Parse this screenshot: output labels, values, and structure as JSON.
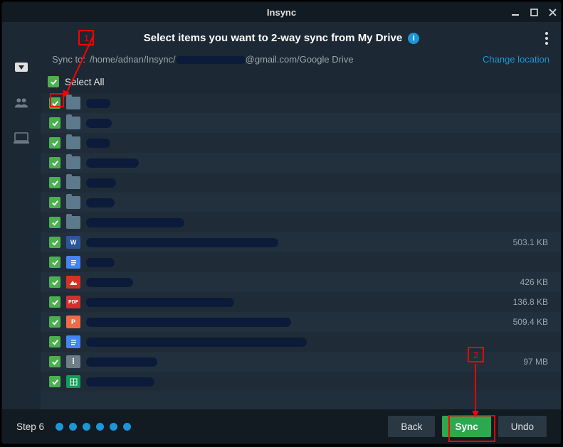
{
  "window": {
    "title": "Insync"
  },
  "header": {
    "title": "Select items you want to 2-way sync from My Drive"
  },
  "sync": {
    "label": "Sync to:",
    "path_prefix": "/home/adnan/Insync/",
    "path_suffix": "@gmail.com/Google Drive",
    "change": "Change location"
  },
  "selectAll": {
    "label": "Select All"
  },
  "items": [
    {
      "kind": "folder",
      "nameWidth": 34,
      "size": ""
    },
    {
      "kind": "folder",
      "nameWidth": 36,
      "size": ""
    },
    {
      "kind": "folder",
      "nameWidth": 34,
      "size": ""
    },
    {
      "kind": "folder",
      "nameWidth": 74,
      "size": ""
    },
    {
      "kind": "folder",
      "nameWidth": 42,
      "size": ""
    },
    {
      "kind": "folder",
      "nameWidth": 40,
      "size": ""
    },
    {
      "kind": "folder",
      "nameWidth": 138,
      "size": ""
    },
    {
      "kind": "word",
      "nameWidth": 270,
      "size": "503.1 KB"
    },
    {
      "kind": "gdoc",
      "nameWidth": 40,
      "size": ""
    },
    {
      "kind": "image",
      "nameWidth": 66,
      "size": "426 KB"
    },
    {
      "kind": "pdf",
      "nameWidth": 208,
      "size": "136.8 KB"
    },
    {
      "kind": "ppt",
      "nameWidth": 288,
      "size": "509.4 KB"
    },
    {
      "kind": "gdoc",
      "nameWidth": 310,
      "size": ""
    },
    {
      "kind": "archive",
      "nameWidth": 100,
      "size": "97 MB"
    },
    {
      "kind": "gsheet",
      "nameWidth": 96,
      "size": ""
    }
  ],
  "footer": {
    "step": "Step 6",
    "back": "Back",
    "sync": "Sync",
    "undo": "Undo"
  },
  "annotations": {
    "box1": {
      "num": "1"
    },
    "box2": {
      "num": "2"
    }
  },
  "icons": {
    "word_label": "W",
    "pdf_label": "PDF",
    "ppt_label": "P"
  }
}
